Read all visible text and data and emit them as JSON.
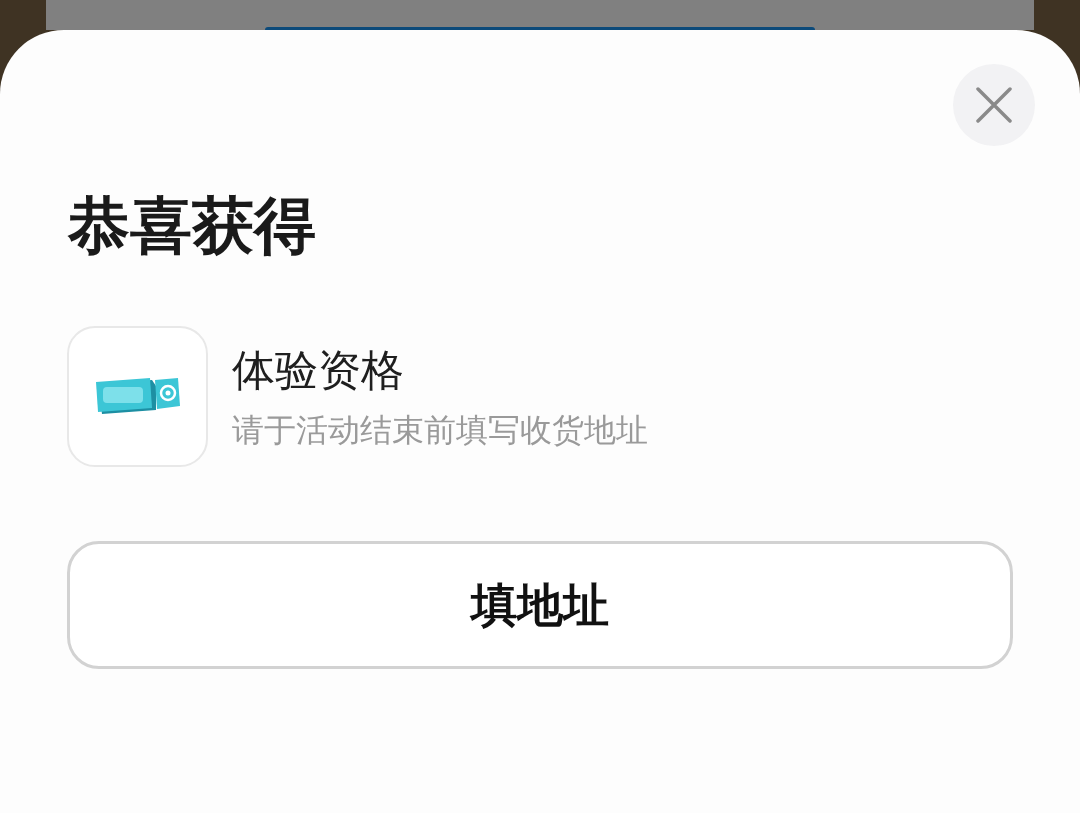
{
  "title": "恭喜获得",
  "prize": {
    "name": "体验资格",
    "note": "请于活动结束前填写收货地址"
  },
  "button": {
    "label": "填地址"
  }
}
